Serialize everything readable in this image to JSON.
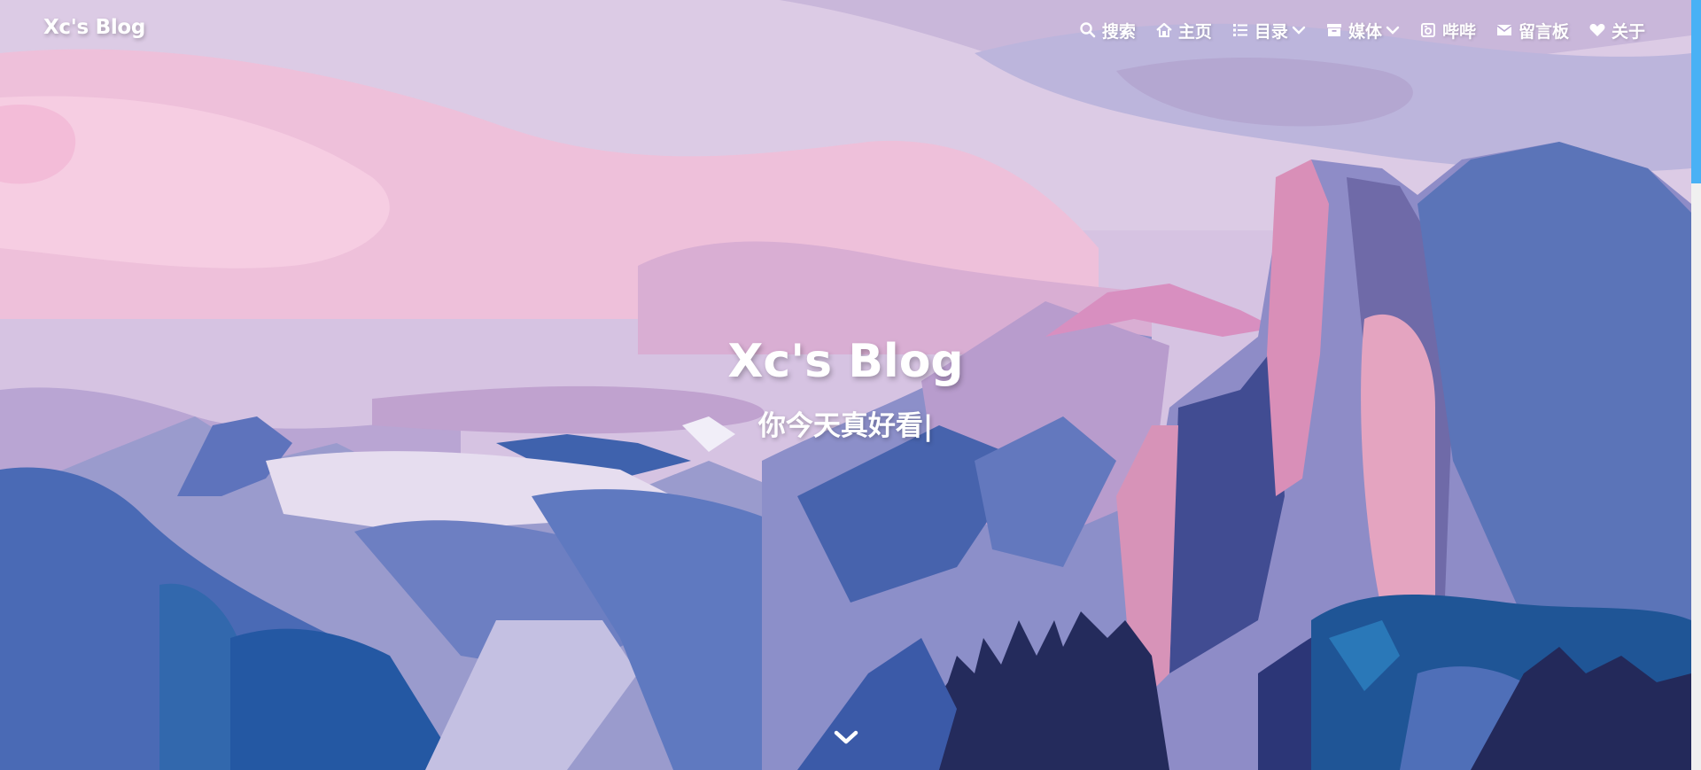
{
  "site": {
    "name": "Xc's Blog"
  },
  "nav": {
    "items": [
      {
        "label": "搜索",
        "icon": "search-icon",
        "dropdown": false
      },
      {
        "label": "主页",
        "icon": "home-icon",
        "dropdown": false
      },
      {
        "label": "目录",
        "icon": "list-icon",
        "dropdown": true
      },
      {
        "label": "媒体",
        "icon": "archive-icon",
        "dropdown": true
      },
      {
        "label": "哔哔",
        "icon": "camera-icon",
        "dropdown": false
      },
      {
        "label": "留言板",
        "icon": "envelope-icon",
        "dropdown": false
      },
      {
        "label": "关于",
        "icon": "heart-icon",
        "dropdown": false
      }
    ]
  },
  "hero": {
    "title": "Xc's Blog",
    "subtitle": "你今天真好看",
    "cursor": "|"
  },
  "colors": {
    "text": "#ffffff",
    "scrollbar_thumb": "#49b1f5",
    "scrollbar_track": "#f0f0f0",
    "sky_top": "#d9c7e3",
    "sky_pink": "#f0c3dc",
    "mountain_blue": "#4d6cb5",
    "mountain_dark": "#23295a"
  }
}
